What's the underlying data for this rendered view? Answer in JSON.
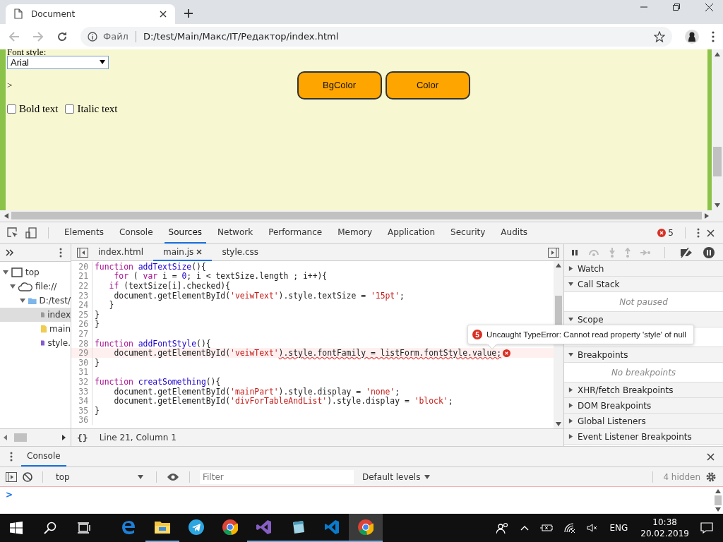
{
  "browser": {
    "tab": {
      "title": "Document"
    },
    "address": {
      "scheme": "Файл",
      "url": "D:/test/Main/Макс/IT/Редактор/index.html"
    }
  },
  "page": {
    "label": "Font style:",
    "select": {
      "value": "Arial"
    },
    "marker": ">",
    "buttons": [
      "BgColor",
      "Color"
    ],
    "checkboxes": [
      {
        "label": "Bold text",
        "checked": false
      },
      {
        "label": "Italic text",
        "checked": false
      }
    ]
  },
  "devtools": {
    "tabs": [
      {
        "label": "Elements",
        "selected": false
      },
      {
        "label": "Console",
        "selected": false
      },
      {
        "label": "Sources",
        "selected": true
      },
      {
        "label": "Network",
        "selected": false
      },
      {
        "label": "Performance",
        "selected": false
      },
      {
        "label": "Memory",
        "selected": false
      },
      {
        "label": "Application",
        "selected": false
      },
      {
        "label": "Security",
        "selected": false
      },
      {
        "label": "Audits",
        "selected": false
      }
    ],
    "error_count": "5",
    "tree": [
      {
        "label": "top",
        "kind": "frame",
        "expanded": true,
        "selected": false,
        "children": [
          {
            "label": "file://",
            "kind": "cloud",
            "expanded": true,
            "selected": false,
            "children": [
              {
                "label": "D:/test/",
                "kind": "folder",
                "expanded": true,
                "selected": false,
                "children": [
                  {
                    "label": "index",
                    "kind": "html",
                    "selected": true
                  },
                  {
                    "label": "main",
                    "kind": "js",
                    "selected": false
                  },
                  {
                    "label": "style.",
                    "kind": "css",
                    "selected": false
                  }
                ]
              }
            ]
          }
        ]
      }
    ],
    "files": [
      {
        "label": "index.html",
        "selected": false
      },
      {
        "label": "main.js",
        "selected": true
      },
      {
        "label": "style.css",
        "selected": false
      }
    ],
    "code": [
      {
        "number": "20",
        "error": false,
        "segments": [
          {
            "kind": "keyword",
            "text": "function"
          },
          {
            "kind": "name",
            "text": " addTextSize"
          },
          {
            "kind": "plain",
            "text": "(){"
          }
        ]
      },
      {
        "number": "21",
        "error": false,
        "segments": [
          {
            "kind": "keyword",
            "text": "    for"
          },
          {
            "kind": "plain",
            "text": " ( "
          },
          {
            "kind": "keyword",
            "text": "var"
          },
          {
            "kind": "plain",
            "text": " i = "
          },
          {
            "kind": "number",
            "text": "0"
          },
          {
            "kind": "plain",
            "text": "; i < textSize.length ; i++){"
          }
        ]
      },
      {
        "number": "22",
        "error": false,
        "segments": [
          {
            "kind": "keyword",
            "text": "   if"
          },
          {
            "kind": "plain",
            "text": " (textSize[i].checked){"
          }
        ]
      },
      {
        "number": "23",
        "error": false,
        "segments": [
          {
            "kind": "plain",
            "text": "    document.getElementById("
          },
          {
            "kind": "string",
            "text": "'veiwText'"
          },
          {
            "kind": "plain",
            "text": ").style.textSize = "
          },
          {
            "kind": "string",
            "text": "'15pt'"
          },
          {
            "kind": "plain",
            "text": ";"
          }
        ]
      },
      {
        "number": "24",
        "error": false,
        "segments": [
          {
            "kind": "plain",
            "text": "   }"
          }
        ]
      },
      {
        "number": "25",
        "error": false,
        "segments": [
          {
            "kind": "plain",
            "text": "}"
          }
        ]
      },
      {
        "number": "26",
        "error": false,
        "segments": [
          {
            "kind": "plain",
            "text": "}"
          }
        ]
      },
      {
        "number": "27",
        "error": false
      },
      {
        "number": "28",
        "error": false,
        "segments": [
          {
            "kind": "keyword",
            "text": "function"
          },
          {
            "kind": "name",
            "text": " addFontStyle"
          },
          {
            "kind": "plain",
            "text": "(){"
          }
        ]
      },
      {
        "number": "29",
        "error": true,
        "segments": [
          {
            "kind": "plain",
            "text": "    document.getElementById("
          },
          {
            "kind": "string",
            "text": "'veiwText'"
          },
          {
            "kind": "plain",
            "text": ").style.fontFamily = listForm.fontStyle.value;"
          }
        ]
      },
      {
        "number": "30",
        "error": false,
        "segments": [
          {
            "kind": "plain",
            "text": "}"
          }
        ]
      },
      {
        "number": "31",
        "error": false
      },
      {
        "number": "32",
        "error": false,
        "segments": [
          {
            "kind": "keyword",
            "text": "function"
          },
          {
            "kind": "name",
            "text": " creatSomething"
          },
          {
            "kind": "plain",
            "text": "(){"
          }
        ]
      },
      {
        "number": "33",
        "error": false,
        "segments": [
          {
            "kind": "plain",
            "text": "    document.getElementById("
          },
          {
            "kind": "string",
            "text": "'mainPart'"
          },
          {
            "kind": "plain",
            "text": ").style.display = "
          },
          {
            "kind": "string",
            "text": "'none'"
          },
          {
            "kind": "plain",
            "text": ";"
          }
        ]
      },
      {
        "number": "34",
        "error": false,
        "segments": [
          {
            "kind": "plain",
            "text": "    document.getElementById("
          },
          {
            "kind": "string",
            "text": "'divForTableAndList'"
          },
          {
            "kind": "plain",
            "text": ").style.display = "
          },
          {
            "kind": "string",
            "text": "'block'"
          },
          {
            "kind": "plain",
            "text": ";"
          }
        ]
      },
      {
        "number": "35",
        "error": false,
        "segments": [
          {
            "kind": "plain",
            "text": "}"
          }
        ]
      },
      {
        "number": "36",
        "error": false
      }
    ],
    "error_tooltip": {
      "count": "5",
      "message": "Uncaught TypeError: Cannot read property 'style' of null"
    },
    "format_button": "{}",
    "status": "Line 21, Column 1",
    "sections": [
      {
        "title": "Watch",
        "expanded": false
      },
      {
        "title": "Call Stack",
        "expanded": true,
        "message": "Not paused"
      },
      {
        "title": "Scope",
        "expanded": true
      },
      {
        "title": "Breakpoints",
        "expanded": true,
        "message": "No breakpoints"
      },
      {
        "title": "XHR/fetch Breakpoints",
        "expanded": false
      },
      {
        "title": "DOM Breakpoints",
        "expanded": false
      },
      {
        "title": "Global Listeners",
        "expanded": false
      },
      {
        "title": "Event Listener Breakpoints",
        "expanded": false
      }
    ]
  },
  "console": {
    "tab": "Console",
    "context": "top",
    "filter": {
      "placeholder": "Filter"
    },
    "levels": "Default levels",
    "hidden": "4 hidden",
    "prompt": ">"
  },
  "taskbar": {
    "apps": [
      {
        "kind": "letter",
        "running": false,
        "selected": false
      },
      {
        "kind": "folder",
        "running": true,
        "selected": false
      },
      {
        "kind": "plane",
        "running": false,
        "selected": false
      },
      {
        "kind": "ball",
        "running": false,
        "selected": false
      },
      {
        "kind": "ribbon",
        "running": true,
        "selected": false
      },
      {
        "kind": "notepad",
        "running": true,
        "selected": false
      },
      {
        "kind": "bracket",
        "running": true,
        "selected": false
      },
      {
        "kind": "ball",
        "running": true,
        "selected": true
      }
    ],
    "language": "ENG",
    "time": "10:38",
    "date": "20.02.2019"
  }
}
